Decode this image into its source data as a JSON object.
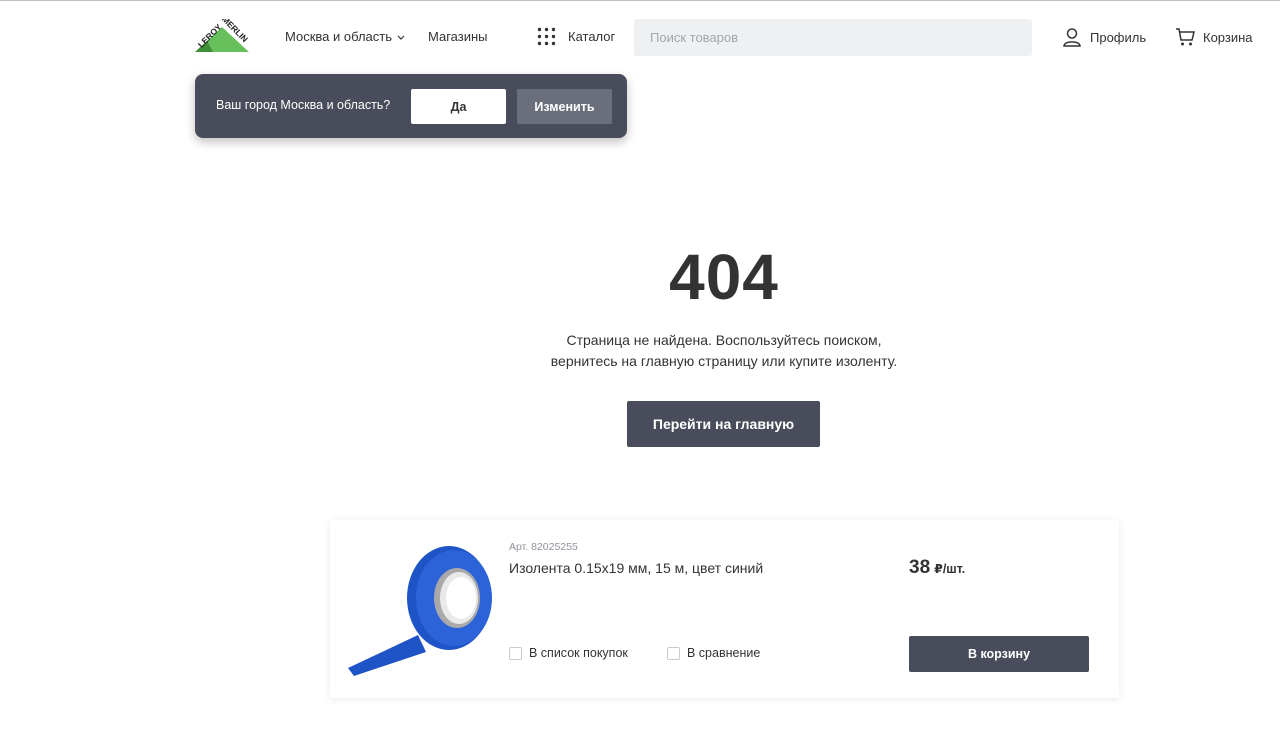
{
  "header": {
    "logo_text_top": "LEROY",
    "logo_text_bottom": "MERLIN",
    "region_label": "Москва и область",
    "stores_label": "Магазины",
    "catalog_label": "Каталог",
    "search_placeholder": "Поиск товаров",
    "profile_label": "Профиль",
    "cart_label": "Корзина"
  },
  "city_popup": {
    "question": "Ваш город Москва и область?",
    "yes_label": "Да",
    "change_label": "Изменить"
  },
  "error": {
    "code": "404",
    "line1": "Страница не найдена. Воспользуйтесь поиском,",
    "line2": "вернитесь на главную страницу или купите изоленту.",
    "home_button": "Перейти на главную"
  },
  "product": {
    "article": "Арт. 82025255",
    "title": "Изолента 0.15х19 мм, 15 м, цвет синий",
    "price": "38",
    "unit": "₽/шт.",
    "shopping_list_label": "В список покупок",
    "compare_label": "В сравнение",
    "add_to_cart_label": "В корзину"
  },
  "colors": {
    "brand_green": "#67c05b",
    "dark_button": "#494d5b",
    "tape_blue": "#1f54c6"
  }
}
